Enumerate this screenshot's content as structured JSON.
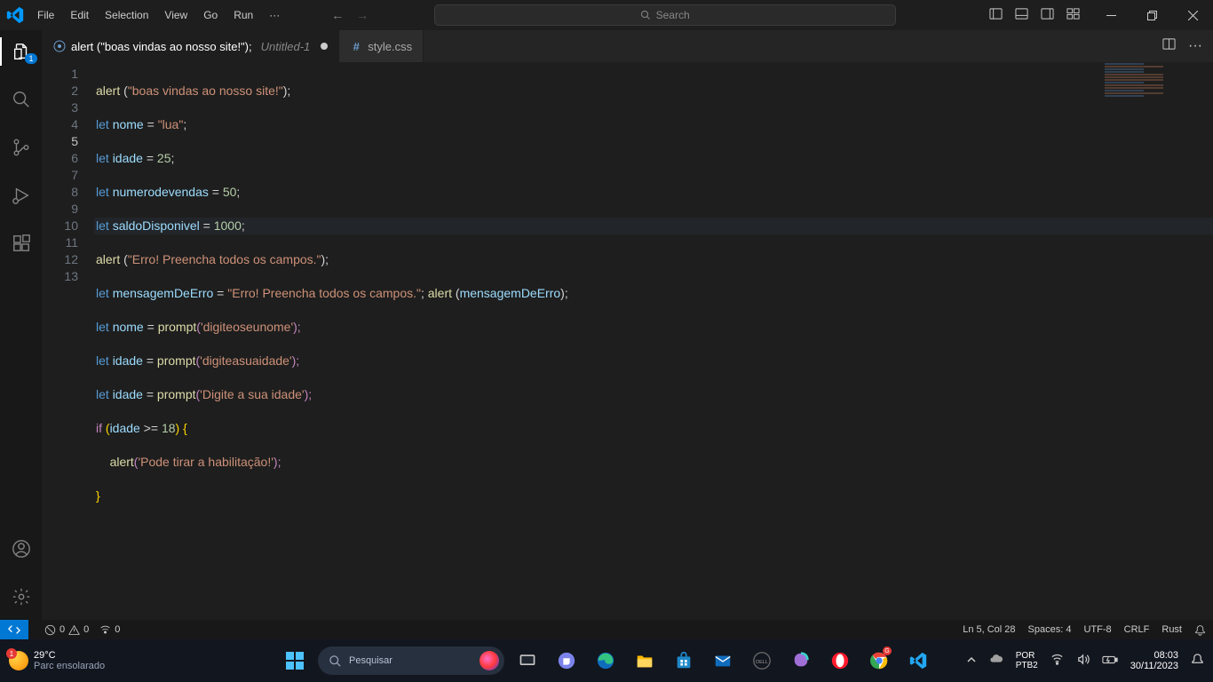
{
  "menu": {
    "items": [
      "File",
      "Edit",
      "Selection",
      "View",
      "Go",
      "Run"
    ],
    "more": "···"
  },
  "search": {
    "placeholder": "Search"
  },
  "tabs": {
    "active": {
      "title": "alert (\"boas vindas ao nosso site!\");",
      "sub": "Untitled-1"
    },
    "other": {
      "title": "style.css"
    }
  },
  "activity": {
    "badge": "1"
  },
  "gutter": {
    "lines": [
      "1",
      "2",
      "3",
      "4",
      "5",
      "6",
      "7",
      "8",
      "9",
      "10",
      "11",
      "12",
      "13"
    ],
    "current": 5
  },
  "code": {
    "l1": {
      "fn": "alert",
      "p1": " (",
      "str": "\"boas vindas ao nosso site!\"",
      "p2": ");"
    },
    "l2": {
      "kw": "let ",
      "var": "nome",
      "op": " = ",
      "str": "\"lua\"",
      "end": ";"
    },
    "l3": {
      "kw": "let ",
      "var": "idade",
      "op": " = ",
      "num": "25",
      "end": ";"
    },
    "l4": {
      "kw": "let ",
      "var": "numerodevendas",
      "op": " = ",
      "num": "50",
      "end": ";"
    },
    "l5": {
      "kw": "let ",
      "var": "saldoDisponivel",
      "op": " = ",
      "num": "1000",
      "end": ";"
    },
    "l6": {
      "fn": "alert",
      "p1": " (",
      "str": "\"Erro! Preencha todos os campos.\"",
      "p2": ");"
    },
    "l7": {
      "kw": "let ",
      "var": "mensagemDeErro",
      "op": " = ",
      "str": "\"Erro! Preencha todos os campos.\"",
      "semi": "; ",
      "fn": "alert",
      "p1": " (",
      "arg": "mensagemDeErro",
      "p2": ");"
    },
    "l8": {
      "kw": "let ",
      "var": "nome",
      "op": " = ",
      "fn": "prompt",
      "p1": "(",
      "str": "'digiteoseunome'",
      "p2": ");"
    },
    "l9": {
      "kw": "let ",
      "var": "idade",
      "op": " = ",
      "fn": "prompt",
      "p1": "(",
      "str": "'digiteasuaidade'",
      "p2": ");"
    },
    "l10": {
      "kw": "let ",
      "var": "idade",
      "op": " = ",
      "fn": "prompt",
      "p1": "(",
      "str": "'Digite a sua idade'",
      "p2": ");"
    },
    "l11": {
      "kw": "if",
      "rest": " (",
      "var": "idade",
      "cmp": " >= ",
      "num": "18",
      "brace": ") {"
    },
    "l12": {
      "pad": "    ",
      "fn": "alert",
      "p1": "(",
      "str": "'Pode tirar a habilitação!'",
      "p2": ");"
    },
    "l13": {
      "brace": "}"
    }
  },
  "status": {
    "errors": "0",
    "warnings": "0",
    "ports": "0",
    "pos": "Ln 5, Col 28",
    "spaces": "Spaces: 4",
    "enc": "UTF-8",
    "eol": "CRLF",
    "lang": "Rust"
  },
  "weather": {
    "temp": "29°C",
    "desc": "Parc ensolarado",
    "badge": "1"
  },
  "tbsearch": {
    "placeholder": "Pesquisar"
  },
  "tray": {
    "lang1": "POR",
    "lang2": "PTB2",
    "time": "08:03",
    "date": "30/11/2023"
  }
}
